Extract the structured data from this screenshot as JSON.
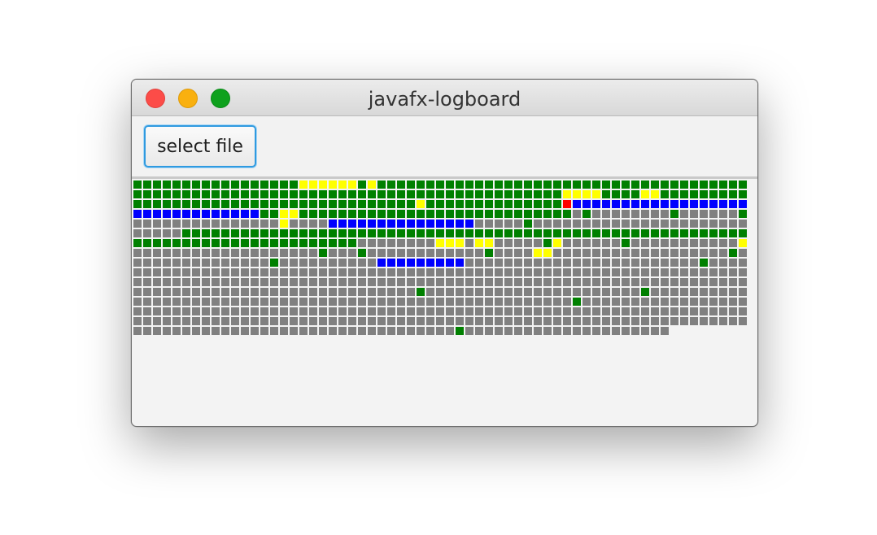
{
  "window": {
    "title": "javafx-logboard"
  },
  "toolbar": {
    "select_file_label": "select file"
  },
  "colors": {
    "info": "#008000",
    "warn": "#ffff00",
    "debug": "#0000ff",
    "error": "#ff0000",
    "trace": "#808080",
    "button_focus": "#2f9ae0"
  },
  "log_grid": {
    "columns": 63,
    "legend": {
      "G": "info",
      "Y": "warn",
      "B": "debug",
      "R": "error",
      "X": "trace"
    },
    "rows": [
      "GGGGGGGGGGGGGGGGGYYYYYYGYGGGGGGGGGGGGGGGGGGGGGGGGGGGGGGGGGGGGGG",
      "GGGGGGGGGGGGGGGGGGGGGGGGGGGGGGGGGGGGGGGGGGGGYYYYGGGGYYGGGGGGGGG",
      "GGGGGGGGGGGGGGGGGGGGGGGGGGGGGYGGGGGGGGGGGGGGRBBBBBBBBBBBBBBBBBB",
      "BBBBBBBBBBBBBGGYYGGGGGGGGGGGGGGGGGGGGGGGGGGGGXGXXXXXXXXGXXXXXXG",
      "XXXXXXXXXXXXXXXYXXXXBBBBBBBBBBBBBBBXXXXXGXXXXXXXXXXXXXXXXXXXXXX",
      "XXXXXGGGGGGGGGGGGGGGGGGGGGGGGGGGGGGGGGGGGGGGGGGGGGGGGGGGGGGGGGG",
      "GGGGGGGGGGGGGGGGGGGGGGGXXXXXXXXYYYXYYXXXXXGYXXXXXXGXXXXXXXXXXXY",
      "XXXXXXXXXXXXXXXXXXXGXXXGXXXXXXXXXXXXGXXXXYYXXXXXXXXXXXXXXXXXXGX",
      "XXXXXXXXXXXXXXGXXXXXXXXXXBBBBBBBBBXXXXXXXXXXXXXXXXXXXXXXXXGXXXX",
      "XXXXXXXXXXXXXXXXXXXXXXXXXXXXXXXXXXXXXXXXXXXXXXXXXXXXXXXXXXXXXXX",
      "XXXXXXXXXXXXXXXXXXXXXXXXXXXXXXXXXXXXXXXXXXXXXXXXXXXXXXXXXXXXXXX",
      "XXXXXXXXXXXXXXXXXXXXXXXXXXXXXGXXXXXXXXXXXXXXXXXXXXXXGXXXXXXXXXX",
      "XXXXXXXXXXXXXXXXXXXXXXXXXXXXXXXXXXXXXXXXXXXXXGXXXXXXXXXXXXXXXXX",
      "XXXXXXXXXXXXXXXXXXXXXXXXXXXXXXXXXXXXXXXXXXXXXXXXXXXXXXXXXXXXXXX",
      "XXXXXXXXXXXXXXXXXXXXXXXXXXXXXXXXXXXXXXXXXXXXXXXXXXXXXXXXXXXXXXX",
      "XXXXXXXXXXXXXXXXXXXXXXXXXXXXXXXXXGXXXXXXXXXXXXXXXXXXXXX"
    ]
  }
}
